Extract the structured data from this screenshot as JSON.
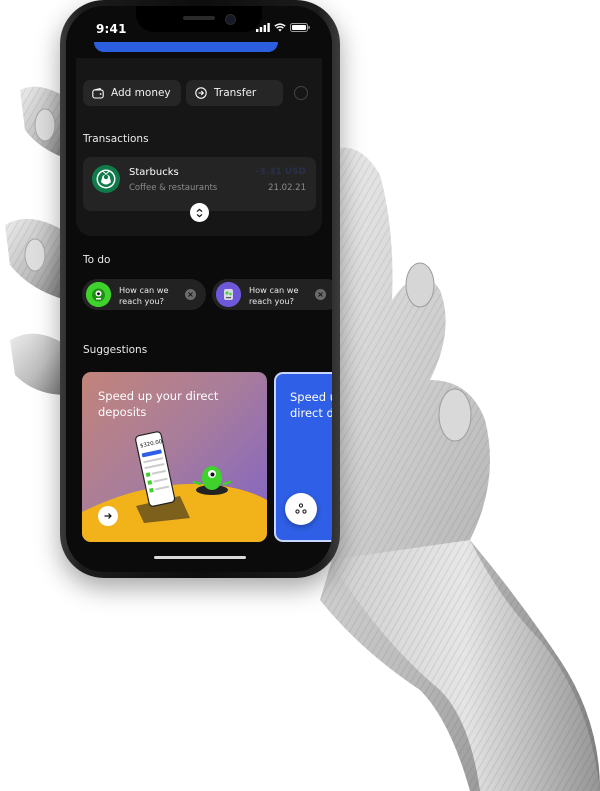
{
  "status_bar": {
    "time": "9:41"
  },
  "actions": {
    "add_money_label": "Add money",
    "transfer_label": "Transfer"
  },
  "transactions": {
    "title": "Transactions",
    "items": [
      {
        "merchant": "Starbucks",
        "category": "Coffee & restaurants",
        "amount": "-3.31 USD",
        "date": "21.02.21",
        "icon": "starbucks-logo"
      }
    ]
  },
  "todo": {
    "title": "To do",
    "items": [
      {
        "text": "How can we reach you?",
        "avatar_color": "#3fd12c"
      },
      {
        "text": "How can we reach you?",
        "avatar_color": "#6e57d9"
      }
    ]
  },
  "suggestions": {
    "title": "Suggestions",
    "cards": [
      {
        "title": "Speed up your direct deposits",
        "phone_amount": "$320.00"
      },
      {
        "title": "Speed up your direct deposits"
      }
    ]
  },
  "colors": {
    "accent_blue": "#2f5fe6",
    "screen_bg": "#0b0b0b",
    "panel_bg": "#161616"
  }
}
